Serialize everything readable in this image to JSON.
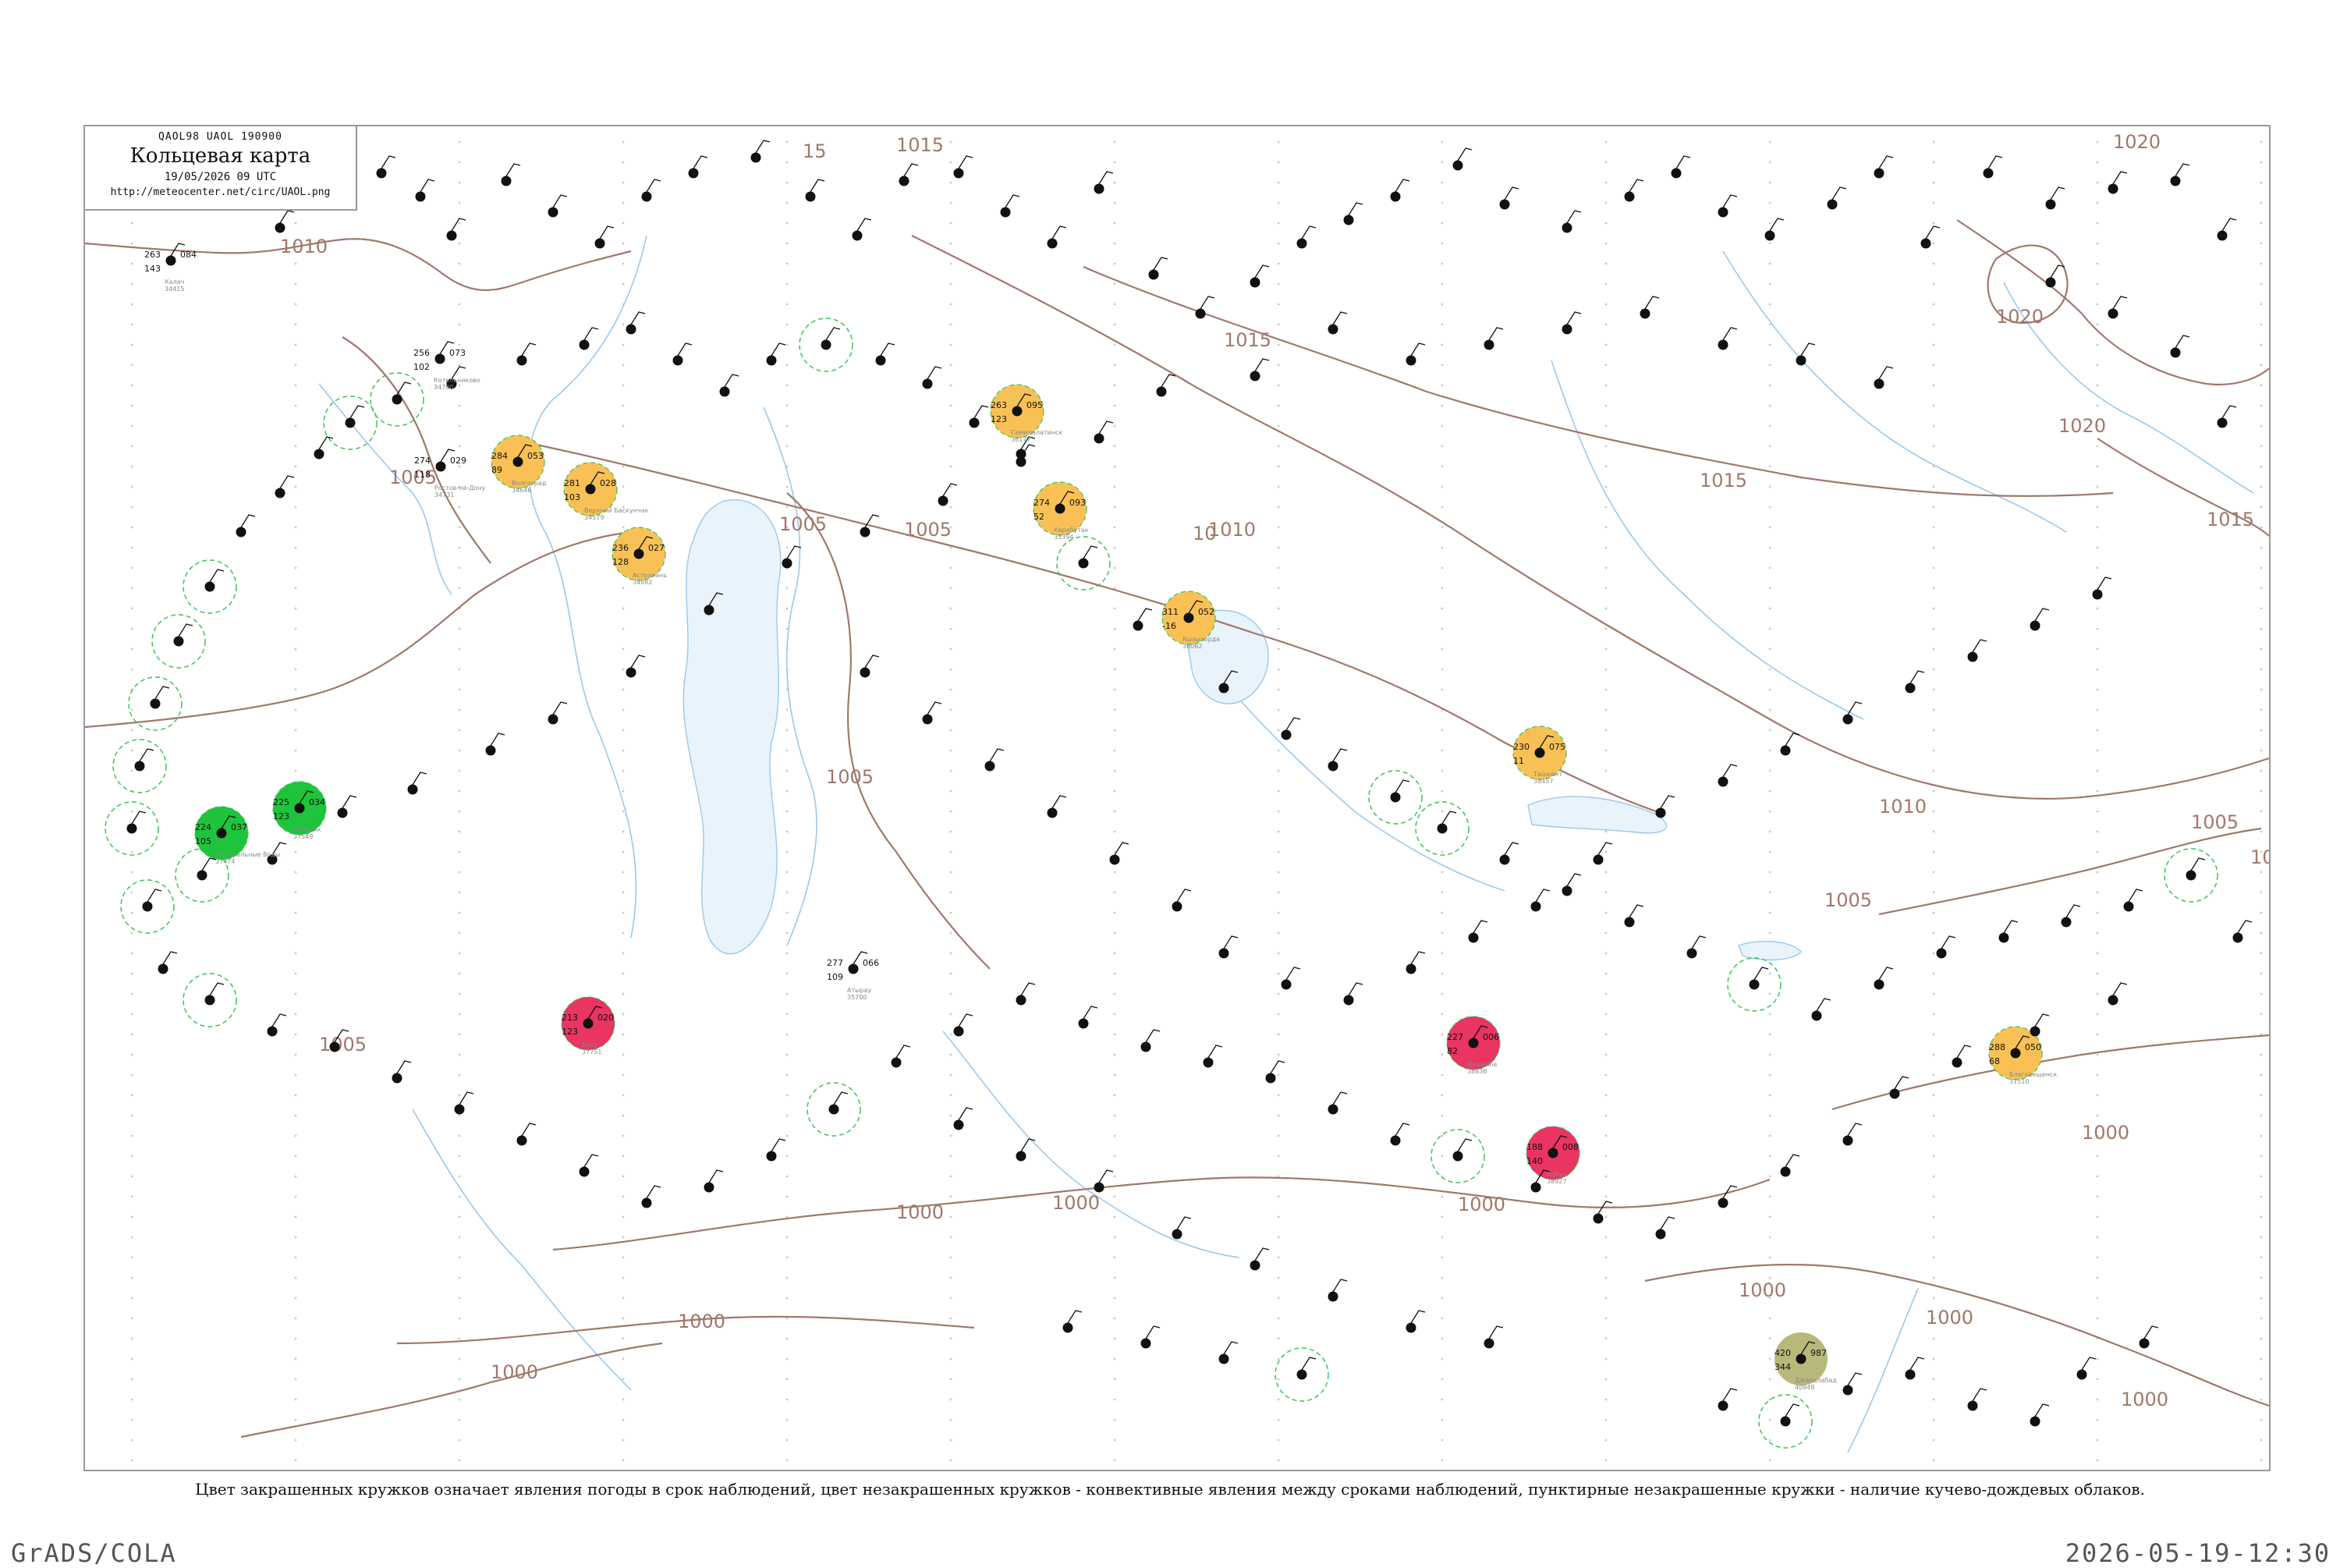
{
  "header": {
    "code": "QAOL98  UAOL  190900",
    "title": "Кольцевая карта",
    "date": "19/05/2026 09 UTC",
    "url": "http://meteocenter.net/circ/UAOL.png"
  },
  "caption": "Цвет закрашенных кружков означает явления погоды в срок наблюдений, цвет незакрашенных кружков - конвективные явления между сроками наблюдений, пунктирные незакрашенные кружки - наличие кучево-дождевых облаков.",
  "footer": {
    "left": "GrADS/COLA",
    "right": "2026-05-19-12:30"
  },
  "colors": {
    "isobar": "#a0786c",
    "river": "#9cc8ec",
    "green_event": "#1ec43c",
    "orange_event": "#f9c155",
    "red_event": "#ea3462",
    "olive_event": "#b8b87a",
    "cb_dashed": "#3cc35a"
  },
  "isobar_labels": [
    "1010",
    "1005",
    "1005",
    "1005",
    "1005",
    "1010",
    "1015",
    "1015",
    "1015",
    "1010",
    "1005",
    "1020",
    "1020",
    "1020",
    "1015",
    "1005",
    "1000",
    "1000",
    "1000",
    "1000",
    "1000",
    "1000",
    "1000",
    "1000",
    "1005",
    "1000",
    "10",
    "15",
    "10"
  ],
  "stations": [
    {
      "id": "34415",
      "name": "Калач",
      "pressure": "084",
      "temp": "263",
      "dew": "143",
      "event": "none"
    },
    {
      "id": "34700",
      "name": "Котельниково",
      "pressure": "073",
      "temp": "256",
      "dew": "102",
      "event": "none"
    },
    {
      "id": "34731",
      "name": "Ростов-на-Дону",
      "pressure": "029",
      "temp": "274",
      "dew": "118",
      "event": "none"
    },
    {
      "id": "34646",
      "name": "Волгоград",
      "pressure": "053",
      "temp": "284",
      "dew": "89",
      "event": "orange"
    },
    {
      "id": "34579",
      "name": "Верхний Баскунчак",
      "pressure": "028",
      "temp": "281",
      "dew": "103",
      "event": "orange"
    },
    {
      "id": "34882",
      "name": "Астрахань",
      "pressure": "027",
      "temp": "236",
      "dew": "128",
      "event": "orange"
    },
    {
      "id": "37474",
      "name": "Минеральные Воды",
      "pressure": "037",
      "temp": "224",
      "dew": "105",
      "event": "green"
    },
    {
      "id": "37549",
      "name": "Нальчик",
      "pressure": "034",
      "temp": "225",
      "dew": "123",
      "event": "green"
    },
    {
      "id": "37751",
      "name": "Баку",
      "pressure": "020",
      "temp": "213",
      "dew": "123",
      "event": "red"
    },
    {
      "id": "35394",
      "name": "Карабутак",
      "pressure": "093",
      "temp": "274",
      "dew": "52",
      "event": "orange"
    },
    {
      "id": "35700",
      "name": "Атырау",
      "pressure": "066",
      "temp": "277",
      "dew": "109",
      "event": "none"
    },
    {
      "id": "38062",
      "name": "Кызылорда",
      "pressure": "052",
      "temp": "311",
      "dew": "-16",
      "event": "orange"
    },
    {
      "id": "36177",
      "name": "Семипалатинск",
      "pressure": "095",
      "temp": "263",
      "dew": "123",
      "event": "orange"
    },
    {
      "id": "38457",
      "name": "Ташкент",
      "pressure": "075",
      "temp": "230",
      "dew": "11",
      "event": "orange"
    },
    {
      "id": "38836",
      "name": "Душанбе",
      "pressure": "006",
      "temp": "227",
      "dew": "82",
      "event": "red"
    },
    {
      "id": "38927",
      "name": "Кабул",
      "pressure": "008",
      "temp": "188",
      "dew": "140",
      "event": "red"
    },
    {
      "id": "40948",
      "name": "Джалалабад",
      "pressure": "987",
      "temp": "420",
      "dew": "344",
      "event": "olive"
    },
    {
      "id": "31510",
      "name": "Благовещенск",
      "pressure": "050",
      "temp": "288",
      "dew": "68",
      "event": "orange"
    }
  ]
}
